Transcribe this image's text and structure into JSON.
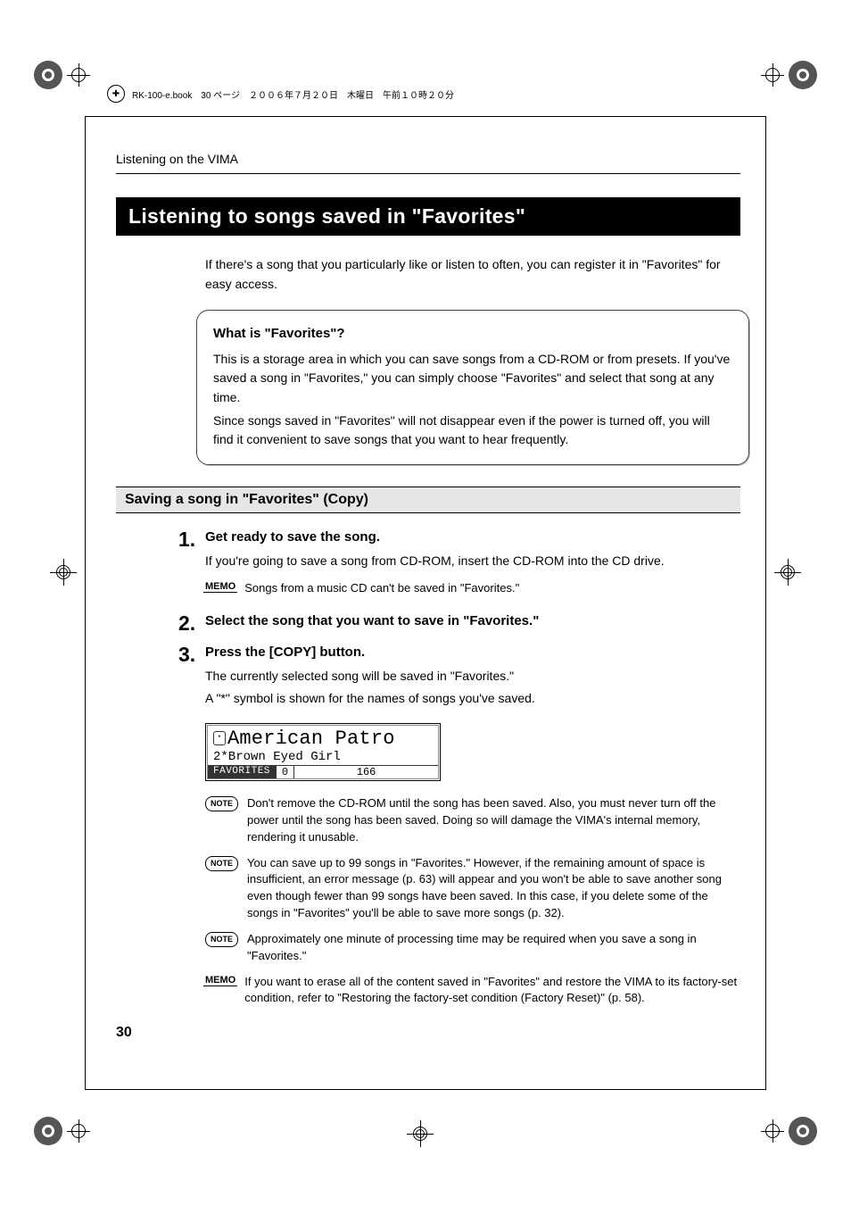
{
  "meta": {
    "book_stamp": "RK-100-e.book　30 ページ　２００６年７月２０日　木曜日　午前１０時２０分"
  },
  "running_head": "Listening on the VIMA",
  "title": "Listening to songs saved in \"Favorites\"",
  "intro": "If there's a song that you particularly like or listen to often, you can register it in \"Favorites\" for easy access.",
  "box": {
    "heading": "What is \"Favorites\"?",
    "p1": "This is a storage area in which you can save songs from a CD-ROM or from presets. If you've saved a song in \"Favorites,\" you can simply choose \"Favorites\" and select that song at any time.",
    "p2": "Since songs saved in \"Favorites\" will not disappear even if the power is turned off, you will find it convenient to save songs that you want to hear frequently."
  },
  "subsection": "Saving a song in \"Favorites\" (Copy)",
  "steps": [
    {
      "num": "1.",
      "title": "Get ready to save the song.",
      "body": "If you're going to save a song from CD-ROM, insert the CD-ROM into the CD drive.",
      "memo": "Songs from a music CD can't be saved in \"Favorites.\""
    },
    {
      "num": "2.",
      "title": "Select the song that you want to save in \"Favorites.\""
    },
    {
      "num": "3.",
      "title": "Press the [COPY] button.",
      "body1": "The currently selected song will be saved in \"Favorites.\"",
      "body2": "A \"*\" symbol is shown for the names of songs you've saved."
    }
  ],
  "lcd": {
    "line1": "American Patro",
    "line2": "2*Brown Eyed Girl",
    "fav": "FAVORITES",
    "col2": "0",
    "col3": "166"
  },
  "notes": [
    {
      "tag": "NOTE",
      "text": "Don't remove the CD-ROM until the song has been saved. Also, you must never turn off the power until the song has been saved. Doing so will damage the VIMA's internal memory, rendering it unusable."
    },
    {
      "tag": "NOTE",
      "text": "You can save up to 99 songs in \"Favorites.\" However, if the remaining amount of space is insufficient, an error message (p. 63) will appear and you won't be able to save another song even though fewer than 99 songs have been saved. In this case, if you delete some of the songs in \"Favorites\" you'll be able to save more songs (p. 32)."
    },
    {
      "tag": "NOTE",
      "text": "Approximately one minute of processing time may be required when you save a song in \"Favorites.\""
    },
    {
      "tag": "MEMO",
      "text": "If you want to erase all of the content saved in \"Favorites\" and restore the VIMA to its factory-set condition, refer to \"Restoring the factory-set condition (Factory Reset)\" (p. 58)."
    }
  ],
  "tags": {
    "note": "NOTE",
    "memo": "MEMO"
  },
  "page_number": "30"
}
